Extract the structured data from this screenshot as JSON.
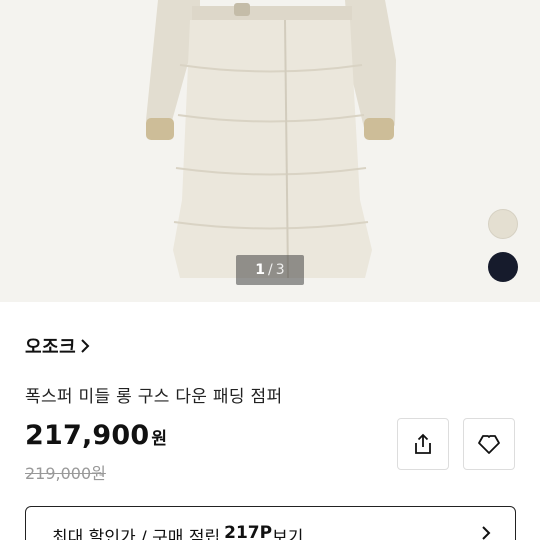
{
  "product_image": {
    "pager": {
      "current": "1",
      "separator": "/",
      "total": "3"
    },
    "color_swatches": [
      {
        "name": "beige",
        "color": "#e4dfd1"
      },
      {
        "name": "navy",
        "color": "#161b2c"
      }
    ]
  },
  "brand": {
    "name": "오조크",
    "icon": "chevron-right-icon"
  },
  "product": {
    "title": "폭스퍼 미들 롱 구스 다운 패딩 점퍼",
    "price": "217,900",
    "price_unit": "원",
    "original_price": "219,000원"
  },
  "actions": {
    "share_icon": "share-icon",
    "like_icon": "heart-outline-icon"
  },
  "benefit": {
    "text_before": "최대 할인가 / 구매 적립",
    "points": "217P",
    "text_after": "보기",
    "icon": "chevron-right-icon"
  },
  "colors": {
    "coat": "#ebe7dc",
    "background": "#f4f3ef",
    "text": "#111111",
    "muted": "#999999"
  }
}
